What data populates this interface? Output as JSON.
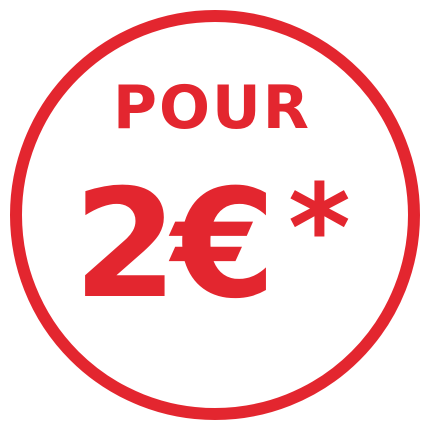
{
  "badge": {
    "label_top": "POUR",
    "amount": "2€",
    "asterisk": "*",
    "accent_color": "#e3262f"
  }
}
